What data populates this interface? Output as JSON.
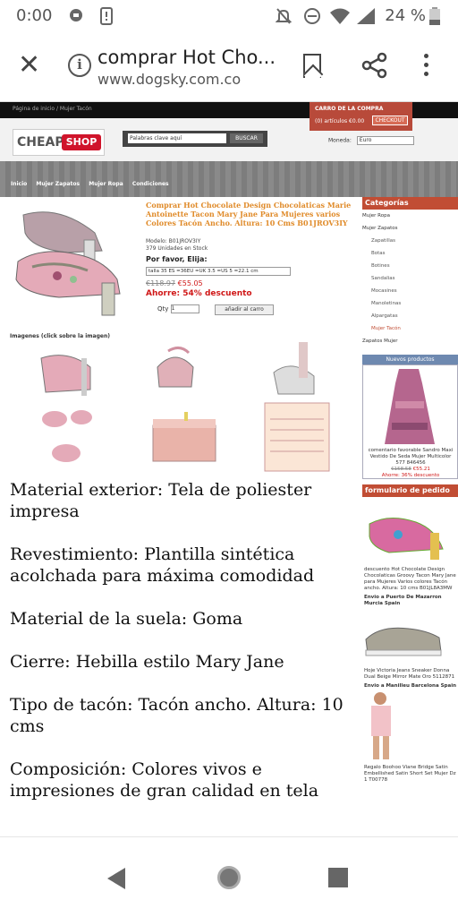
{
  "statusbar": {
    "time": "0:00",
    "battery": "24 %"
  },
  "browser": {
    "title": "comprar Hot Cho...",
    "domain": "www.dogsky.com.co"
  },
  "site": {
    "crumbs": "Página de inicio   /   Mujer Tacón",
    "cart_title": "CARRO DE LA COMPRA",
    "cart_summary": "(0) artículos €0.00",
    "checkout_label": "CHECKOUT",
    "logo_left": "CHEAP",
    "logo_right": "SHOP",
    "search_value": "Palabras clave aquí",
    "search_button": "BUSCAR",
    "currency_label": "Moneda:",
    "currency_value": "Euro",
    "nav": [
      "Inicio",
      "Mujer Zapatos",
      "Mujer Ropa",
      "Condiciones"
    ]
  },
  "product": {
    "title": "Comprar Hot Chocolate Design Chocolaticas Marie Antoinette Tacon Mary Jane Para Mujeres varios Colores Tacón Ancho. Altura: 10 Cms B01JROV3IY",
    "model": "Modelo: B01JROV3IY",
    "stock": "379 Unidades en Stock",
    "choose_label": "Por favor, Elija:",
    "size_value": "talla   35 ES =36EU =UK 3.5 =US 5 =22.1 cm",
    "price_old": "€118.97",
    "price_new": "€55.05",
    "saving": "Ahorre: 54% descuento",
    "qty_label": "Qty",
    "qty_value": "1",
    "add_to_cart": "añadir al carro",
    "images_label": "Imagenes (click sobre la imagen)"
  },
  "description": [
    "Material exterior: Tela de poliester impresa",
    "Revestimiento: Plantilla sintética acolchada para máxima comodidad",
    "Material de la suela: Goma",
    "Cierre: Hebilla estilo Mary Jane",
    "Tipo de tacón: Tacón ancho. Altura: 10 cms",
    "Composición: Colores vivos e impresiones de gran calidad en tela"
  ],
  "sidebar": {
    "categories_title": "Categorías",
    "cat1": "Mujer Ropa",
    "cat2": "Mujer Zapatos",
    "sub": [
      "Zapatillas",
      "Botas",
      "Botines",
      "Sandalias",
      "Mocasines",
      "Manoletinas",
      "Alpargatas"
    ],
    "highlight": "Mujer Tacón",
    "cat3": "Zapatos Mujer",
    "news_title": "Nuevos productos",
    "news_caption": "comentario favorable Sandro Maxi Vestido De Seda Mujer Multicolor 577 846456",
    "news_price_old": "€158.58",
    "news_price_new": "€55.21",
    "news_saving": "Ahorre: 36% descuento",
    "order_title": "formulario de pedido",
    "order1": "descuento Hot Chocolate Design Chocolaticas Groovy Tacon Mary Jane para Mujeres Varios colores Tacón ancho. Altura: 10 cms B01JL8A3MW",
    "order1_meta": "Envio a Puerto De Mazarron Murcia Spain",
    "order2": "Hoje Victoria Jeans Sneaker Donna Dual Beige Mirror Mate Oro 5112871",
    "order2_meta": "Envio a Manilleu Barcelona Spain",
    "order3": "Regalo Boohoo Viane Bridge Satin Embellished Satin Short Set Mujer Dz 1 T00778"
  },
  "colors": {
    "accent": "#c14d34",
    "price_red": "#d01818",
    "title_orange": "#e08b2a"
  }
}
